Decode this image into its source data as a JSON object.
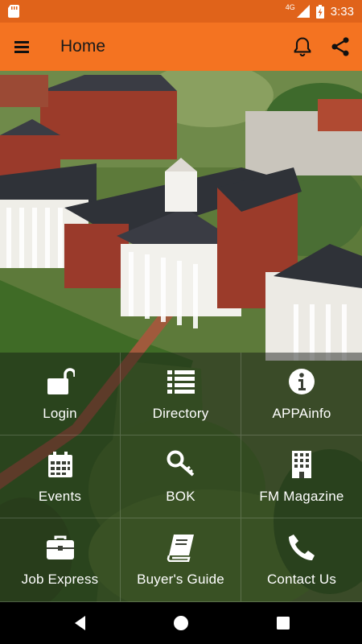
{
  "status_bar": {
    "network": "4G",
    "time": "3:33"
  },
  "app_bar": {
    "title": "Home"
  },
  "tiles": [
    {
      "label": "Login",
      "icon": "unlock-icon"
    },
    {
      "label": "Directory",
      "icon": "list-icon"
    },
    {
      "label": "APPAinfo",
      "icon": "info-icon"
    },
    {
      "label": "Events",
      "icon": "calendar-icon"
    },
    {
      "label": "BOK",
      "icon": "key-icon"
    },
    {
      "label": "FM Magazine",
      "icon": "building-icon"
    },
    {
      "label": "Job Express",
      "icon": "briefcase-icon"
    },
    {
      "label": "Buyer's Guide",
      "icon": "book-icon"
    },
    {
      "label": "Contact Us",
      "icon": "phone-icon"
    }
  ],
  "colors": {
    "app_bar": "#f47321",
    "status_bar": "#e0631a",
    "tile_text": "#ffffff"
  }
}
